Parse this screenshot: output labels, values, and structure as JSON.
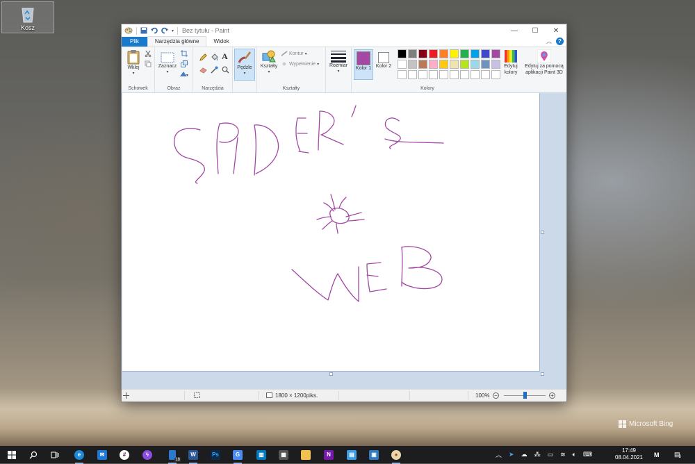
{
  "desktop": {
    "recycle_bin_label": "Kosz",
    "bing_label": "Microsoft Bing"
  },
  "window": {
    "title": "Bez tytułu - Paint",
    "controls": {
      "minimize": "—",
      "maximize": "☐",
      "close": "✕"
    }
  },
  "tabs": {
    "file": "Plik",
    "home": "Narzędzia główne",
    "view": "Widok"
  },
  "ribbon": {
    "clipboard": {
      "paste": "Wklej",
      "label": "Schowek"
    },
    "image": {
      "select": "Zaznacz",
      "label": "Obraz"
    },
    "tools": {
      "label": "Narzędzia"
    },
    "brushes": {
      "label": "Pędzle"
    },
    "shapes": {
      "shapes_btn": "Kształty",
      "outline": "Kontur",
      "fill": "Wypełnienie",
      "label": "Kształty"
    },
    "size": {
      "label": "Rozmiar"
    },
    "colors": {
      "color1": "Kolor 1",
      "color2": "Kolor 2",
      "edit_colors": "Edytuj kolory",
      "paint3d": "Edytuj za pomocą aplikacji Paint 3D",
      "label": "Kolory",
      "color1_value": "#a349a4",
      "color2_value": "#ffffff",
      "palette": [
        "#000000",
        "#7f7f7f",
        "#880015",
        "#ed1c24",
        "#ff7f27",
        "#fff200",
        "#22b14c",
        "#00a2e8",
        "#3f48cc",
        "#a349a4",
        "#ffffff",
        "#c3c3c3",
        "#b97a57",
        "#ffaec9",
        "#ffc90e",
        "#efe4b0",
        "#b5e61d",
        "#99d9ea",
        "#7092be",
        "#c8bfe7",
        "#ffffff",
        "#ffffff",
        "#ffffff",
        "#ffffff",
        "#ffffff",
        "#ffffff",
        "#ffffff",
        "#ffffff",
        "#ffffff",
        "#ffffff"
      ]
    }
  },
  "canvas": {
    "stroke_color": "#a349a4"
  },
  "status": {
    "dimensions": "1800 × 1200piks.",
    "zoom": "100%"
  },
  "taskbar": {
    "mail_badge": "18",
    "time": "17:49",
    "date": "08.04.2021",
    "notification_count": "3"
  }
}
